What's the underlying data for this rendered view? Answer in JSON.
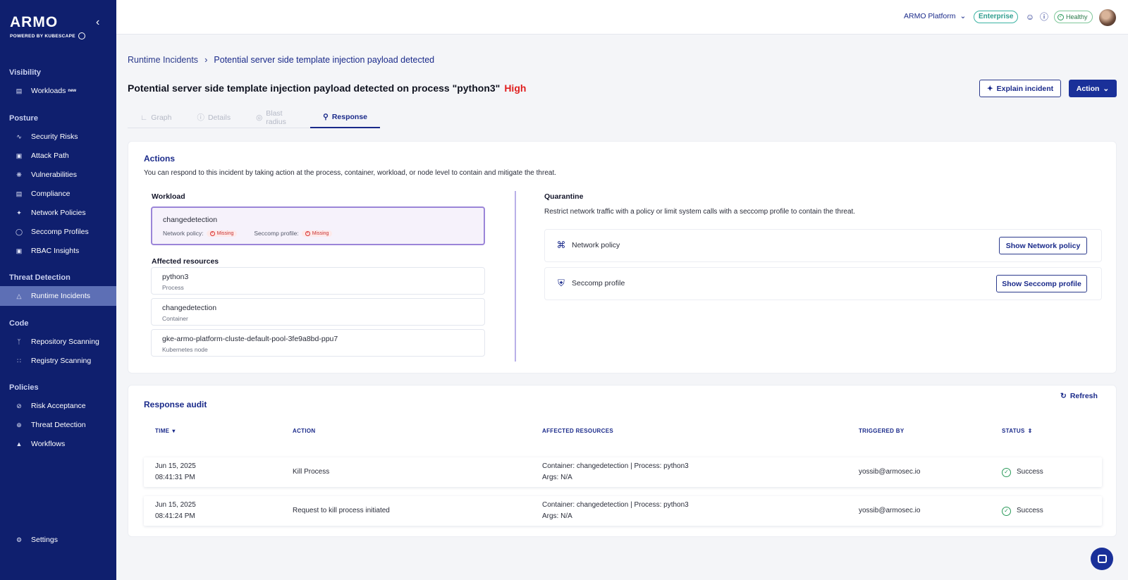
{
  "brand": {
    "logo": "ARMO",
    "powered_by": "POWERED BY KUBESCAPE"
  },
  "sidebar": {
    "sections": [
      {
        "title": "Visibility",
        "items": [
          {
            "label": "Workloads",
            "badge": "new",
            "icon": "workloads-icon"
          }
        ]
      },
      {
        "title": "Posture",
        "items": [
          {
            "label": "Security Risks",
            "icon": "trend-icon"
          },
          {
            "label": "Attack Path",
            "icon": "lock-icon"
          },
          {
            "label": "Vulnerabilities",
            "icon": "bug-icon"
          },
          {
            "label": "Compliance",
            "icon": "document-icon"
          },
          {
            "label": "Network Policies",
            "icon": "network-icon"
          },
          {
            "label": "Seccomp Profiles",
            "icon": "shield-icon"
          },
          {
            "label": "RBAC Insights",
            "icon": "lock-icon"
          }
        ]
      },
      {
        "title": "Threat Detection",
        "items": [
          {
            "label": "Runtime Incidents",
            "icon": "warning-icon",
            "active": true
          }
        ]
      },
      {
        "title": "Code",
        "items": [
          {
            "label": "Repository Scanning",
            "icon": "branch-icon"
          },
          {
            "label": "Registry Scanning",
            "icon": "grid-icon"
          }
        ]
      },
      {
        "title": "Policies",
        "items": [
          {
            "label": "Risk Acceptance",
            "icon": "eye-off-icon"
          },
          {
            "label": "Threat Detection",
            "icon": "magnifier-icon"
          },
          {
            "label": "Workflows",
            "icon": "flow-icon"
          }
        ]
      }
    ],
    "settings": "Settings"
  },
  "topbar": {
    "platform": "ARMO Platform",
    "plan": "Enterprise",
    "health": "Healthy"
  },
  "breadcrumb": {
    "parent": "Runtime Incidents",
    "current": "Potential server side template injection payload detected"
  },
  "incident": {
    "title": "Potential server side template injection payload detected on process \"python3\"",
    "severity": "High",
    "severity_color": "#e02020"
  },
  "buttons": {
    "explain": "Explain incident",
    "action": "Action"
  },
  "tabs": [
    "Graph",
    "Details",
    "Blast radius",
    "Response"
  ],
  "actions": {
    "title": "Actions",
    "description": "You can respond to this incident by taking action at the process, container, workload, or node level to contain and mitigate the threat.",
    "workload_label": "Workload",
    "workload": {
      "name": "changedetection",
      "network_policy_label": "Network policy:",
      "network_policy_status": "Missing",
      "seccomp_profile_label": "Seccomp profile:",
      "seccomp_profile_status": "Missing"
    },
    "affected_label": "Affected resources",
    "resources": [
      {
        "name": "python3",
        "type": "Process"
      },
      {
        "name": "changedetection",
        "type": "Container"
      },
      {
        "name": "gke-armo-platform-cluste-default-pool-3fe9a8bd-ppu7",
        "type": "Kubernetes node"
      }
    ],
    "quarantine_label": "Quarantine",
    "quarantine_desc": "Restrict network traffic with a policy or limit system calls with a seccomp profile to contain the threat.",
    "quarantine_items": [
      {
        "label": "Network policy",
        "button": "Show Network policy"
      },
      {
        "label": "Seccomp profile",
        "button": "Show Seccomp profile"
      }
    ]
  },
  "audit": {
    "title": "Response audit",
    "refresh": "Refresh",
    "columns": [
      "TIME",
      "ACTION",
      "AFFECTED RESOURCES",
      "TRIGGERED BY",
      "STATUS"
    ],
    "rows": [
      {
        "date": "Jun 15, 2025",
        "time": "08:41:31 PM",
        "action": "Kill Process",
        "resources": "Container: changedetection | Process: python3",
        "args": "Args: N/A",
        "triggered_by": "yossib@armosec.io",
        "status": "Success"
      },
      {
        "date": "Jun 15, 2025",
        "time": "08:41:24 PM",
        "action": "Request to kill process initiated",
        "resources": "Container: changedetection | Process: python3",
        "args": "Args: N/A",
        "triggered_by": "yossib@armosec.io",
        "status": "Success"
      }
    ]
  }
}
